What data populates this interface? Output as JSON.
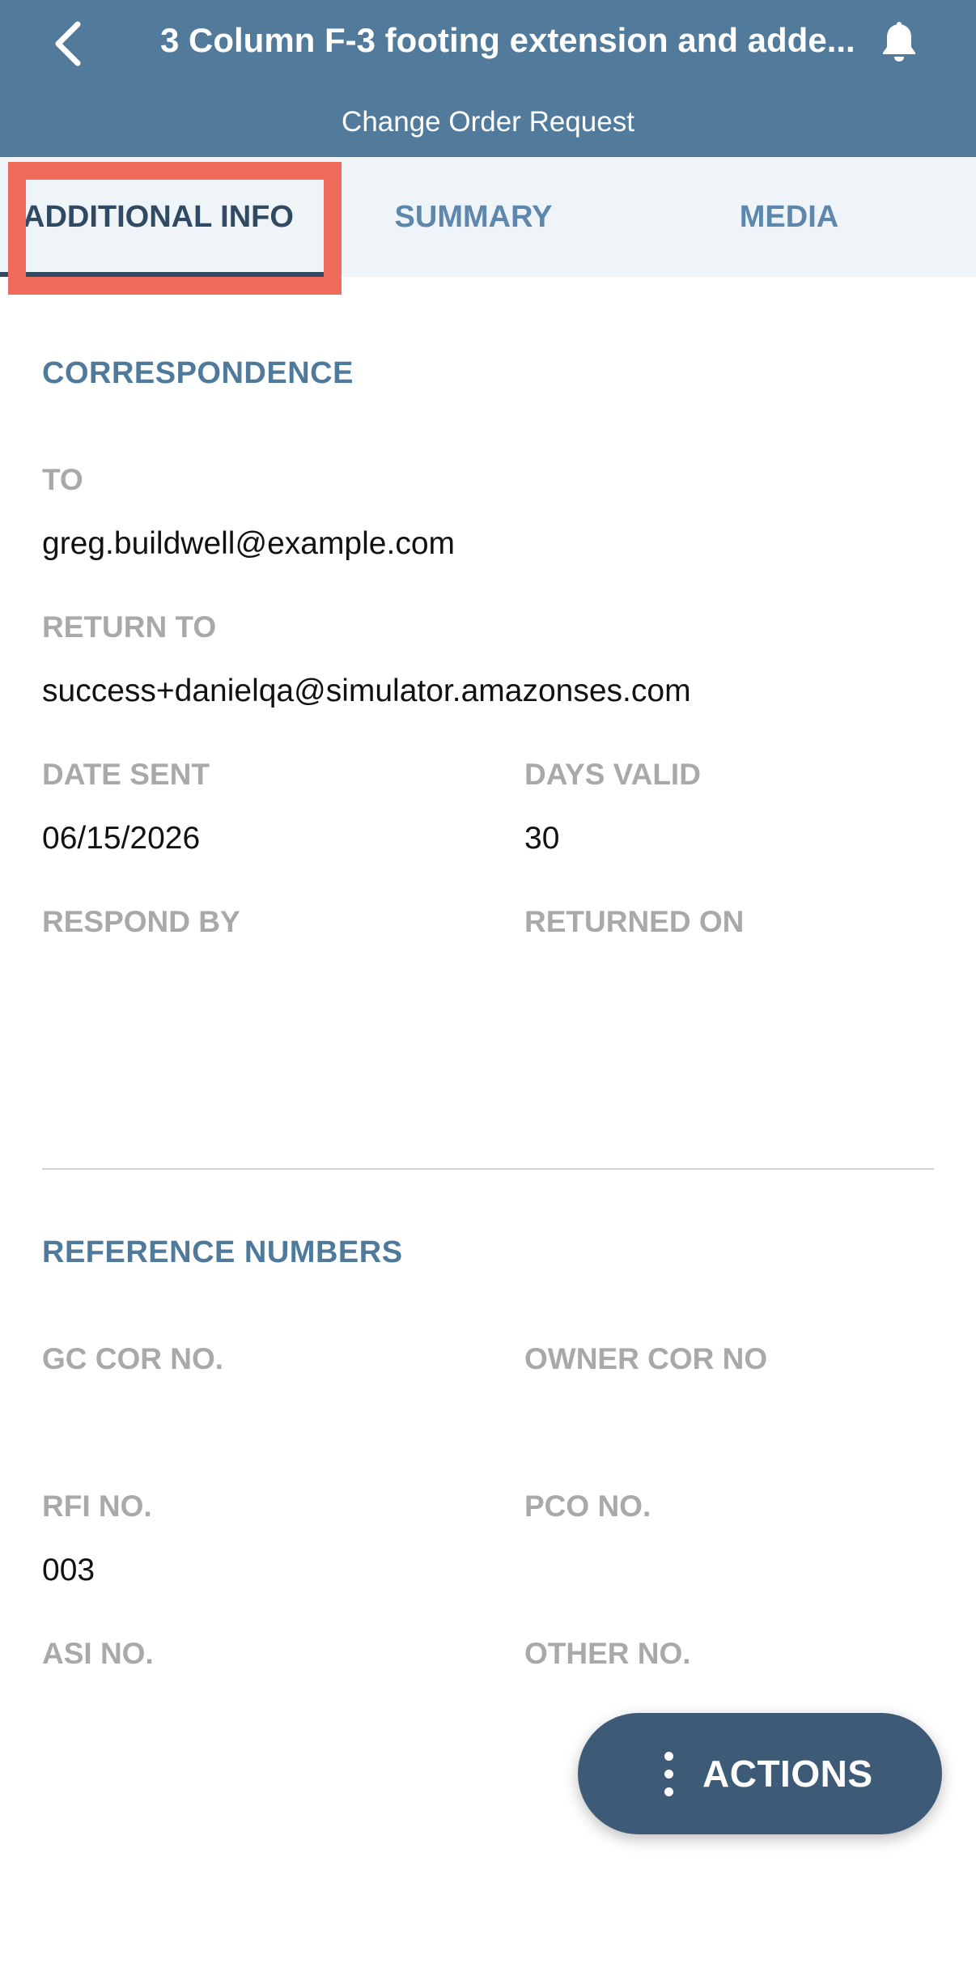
{
  "header": {
    "title": "3 Column F-3 footing extension and adde...",
    "subtitle": "Change Order Request",
    "back_icon": "chevron-left-icon",
    "bell_icon": "bell-icon"
  },
  "tabs": [
    {
      "label": "ADDITIONAL INFO",
      "active": true
    },
    {
      "label": "SUMMARY",
      "active": false
    },
    {
      "label": "MEDIA",
      "active": false
    }
  ],
  "correspondence": {
    "title": "CORRESPONDENCE",
    "to_label": "TO",
    "to_value": "greg.buildwell@example.com",
    "return_to_label": "RETURN TO",
    "return_to_value": "success+danielqa@simulator.amazonses.com",
    "date_sent_label": "DATE SENT",
    "date_sent_value": "06/15/2026",
    "days_valid_label": "DAYS VALID",
    "days_valid_value": "30",
    "respond_by_label": "RESPOND BY",
    "respond_by_value": "",
    "returned_on_label": "RETURNED ON",
    "returned_on_value": ""
  },
  "reference_numbers": {
    "title": "REFERENCE NUMBERS",
    "gc_cor_label": "GC COR NO.",
    "gc_cor_value": "",
    "owner_cor_label": "OWNER COR NO",
    "owner_cor_value": "",
    "rfi_label": "RFI NO.",
    "rfi_value": "003",
    "pco_label": "PCO NO.",
    "pco_value": "",
    "asi_label": "ASI NO.",
    "asi_value": "",
    "other_label": "OTHER NO.",
    "other_value": ""
  },
  "actions": {
    "label": "ACTIONS",
    "icon": "more-vertical-icon"
  },
  "colors": {
    "header_bg": "#527a9b",
    "tab_bar_bg": "#eff4f8",
    "tab_active": "#2f4a62",
    "tab_inactive": "#5d87ad",
    "section_title": "#4f7a9c",
    "field_label": "#a9a9a9",
    "highlight": "#ef6c5c",
    "actions_bg": "#3d5a77"
  }
}
